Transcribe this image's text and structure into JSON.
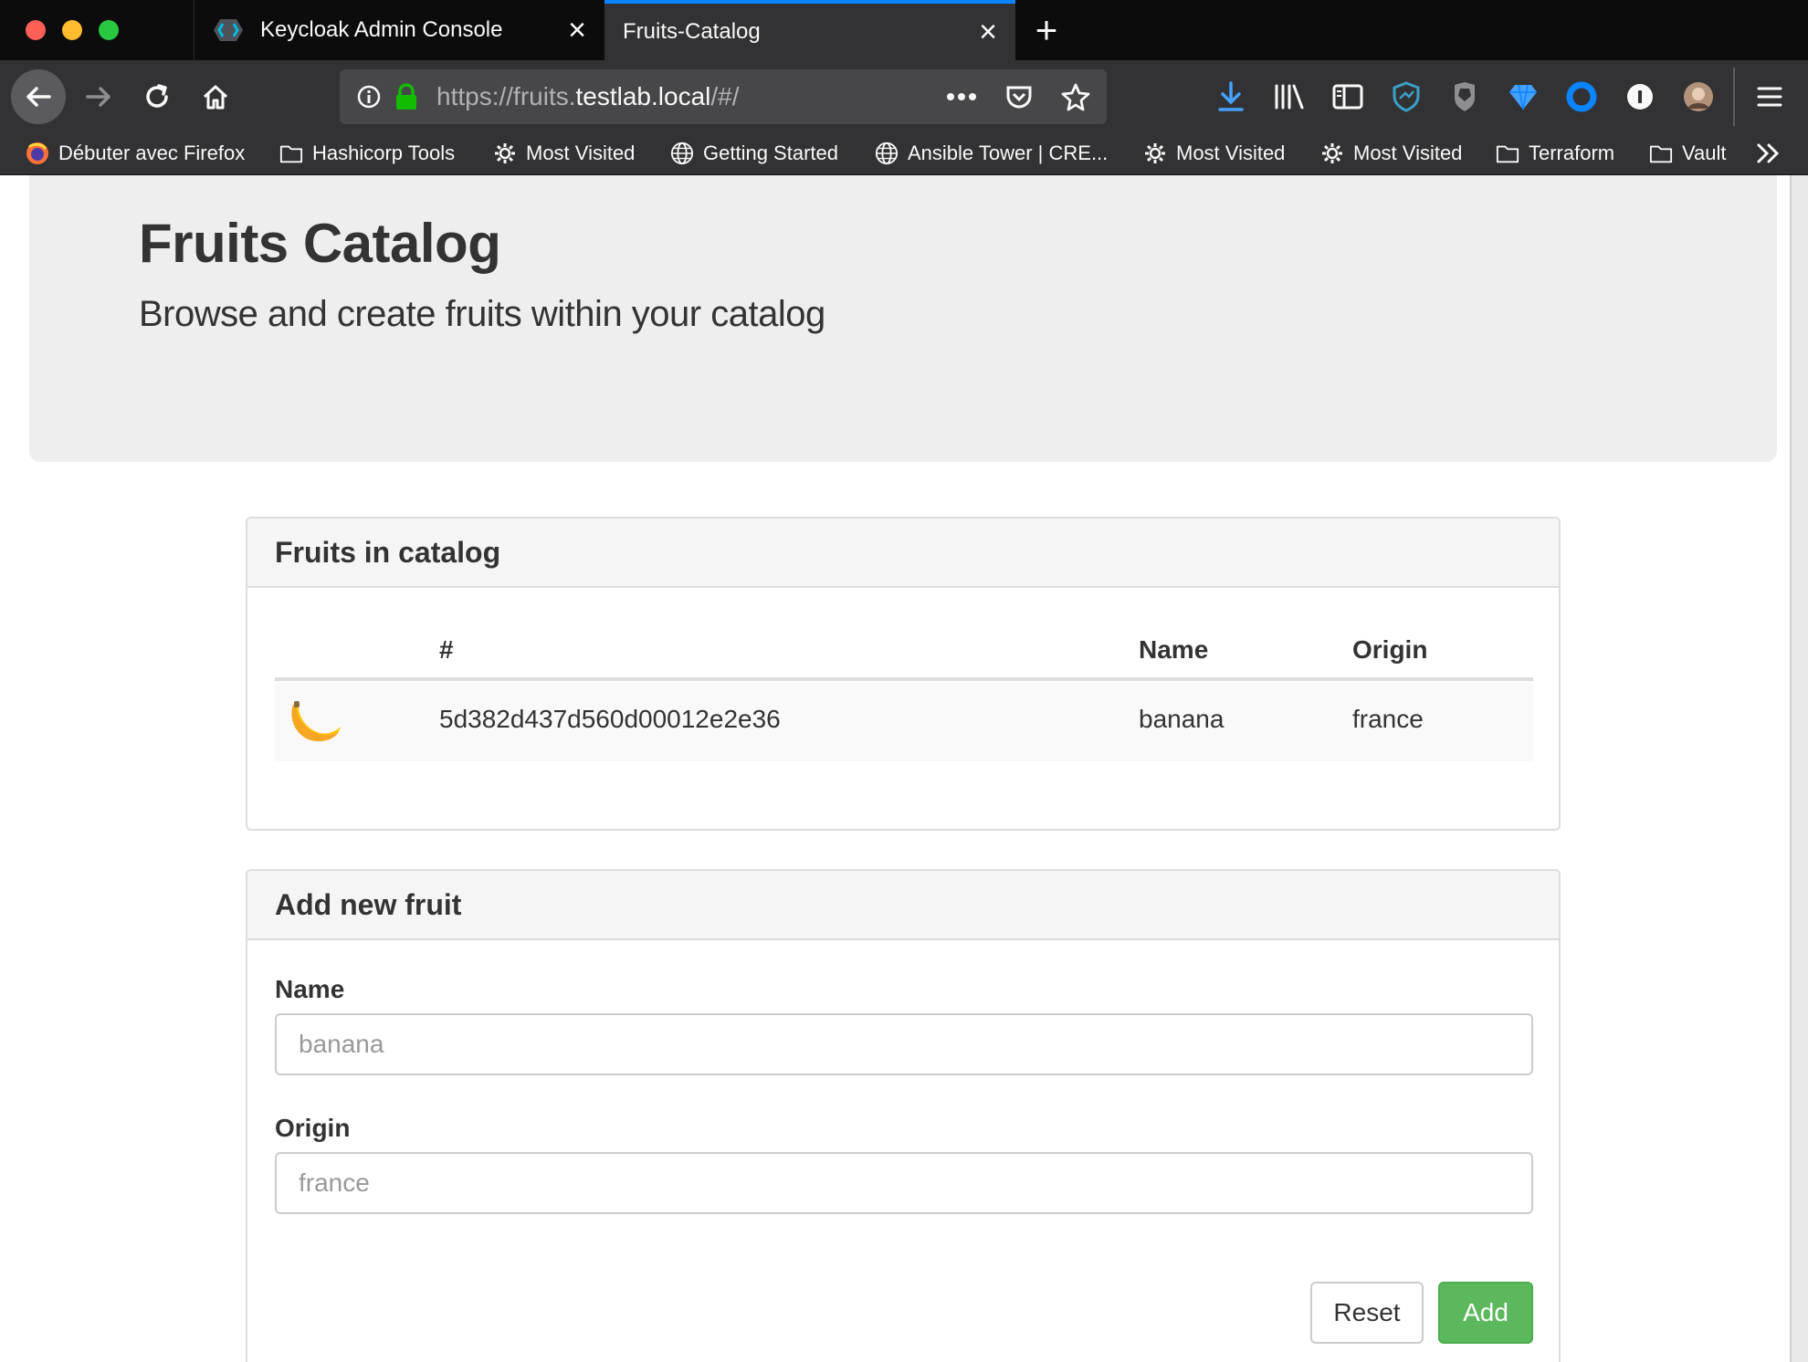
{
  "browser": {
    "tabs": [
      {
        "label": "Keycloak Admin Console",
        "active": false,
        "icon": "keycloak-icon"
      },
      {
        "label": "Fruits-Catalog",
        "active": true
      }
    ],
    "url": {
      "prefix": "https://fruits.",
      "host": "testlab.local",
      "suffix": "/#/"
    },
    "bookmarks": [
      {
        "label": "Débuter avec Firefox",
        "icon": "firefox-icon"
      },
      {
        "label": "Hashicorp Tools",
        "icon": "folder-icon"
      },
      {
        "label": "Most Visited",
        "icon": "gear-icon"
      },
      {
        "label": "Getting Started",
        "icon": "globe-icon"
      },
      {
        "label": "Ansible Tower | CRE...",
        "icon": "globe-icon"
      },
      {
        "label": "Most Visited",
        "icon": "gear-icon"
      },
      {
        "label": "Most Visited",
        "icon": "gear-icon"
      },
      {
        "label": "Terraform",
        "icon": "folder-icon"
      },
      {
        "label": "Vault",
        "icon": "folder-icon"
      }
    ],
    "accent_color": "#0a84ff"
  },
  "page": {
    "title": "Fruits Catalog",
    "subtitle": "Browse and create fruits within your catalog",
    "catalog_panel": {
      "heading": "Fruits in catalog",
      "columns": [
        "",
        "#",
        "Name",
        "Origin"
      ],
      "rows": [
        {
          "image": "banana-icon",
          "id": "5d382d437d560d00012e2e36",
          "name": "banana",
          "origin": "france"
        }
      ]
    },
    "form_panel": {
      "heading": "Add new fruit",
      "name_label": "Name",
      "name_placeholder": "banana",
      "origin_label": "Origin",
      "origin_placeholder": "france",
      "reset_label": "Reset",
      "add_label": "Add",
      "add_color": "#5cb85c"
    }
  }
}
